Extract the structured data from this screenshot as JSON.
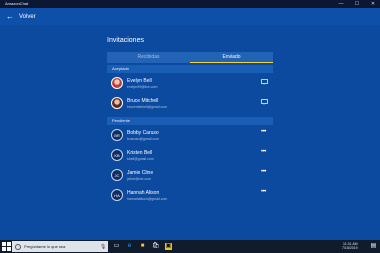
{
  "window": {
    "app_title": "AmazonChat",
    "controls": [
      "—",
      "☐",
      "✕"
    ]
  },
  "header": {
    "back_label": "Volver"
  },
  "page": {
    "title": "Invitaciones"
  },
  "tabs": [
    {
      "label": "Recibidas",
      "selected": false
    },
    {
      "label": "Enviado",
      "selected": true
    }
  ],
  "sections": {
    "accepted": {
      "label": "Aceptado",
      "items": [
        {
          "name": "Evelyn Bell",
          "email": "evelyn99@live.com",
          "avatar": "photo"
        },
        {
          "name": "Bruce Mitchell",
          "email": "brucemitchell@gmail.com",
          "avatar": "photo"
        }
      ]
    },
    "pending": {
      "label": "Pendiente",
      "items": [
        {
          "name": "Bobby Caruso",
          "email": "bcaruso@gmail.com",
          "initials": "BR"
        },
        {
          "name": "Kristen Bell",
          "email": "kbell@gmail.com",
          "initials": "KB"
        },
        {
          "name": "Jamie Cline",
          "email": "jcline@me.com",
          "initials": "JC"
        },
        {
          "name": "Hannah Alison",
          "email": "hannahalison@gmail.com",
          "initials": "HA"
        }
      ]
    }
  },
  "taskbar": {
    "search_placeholder": "Pregúntame lo que sea",
    "time": "11:31 AM",
    "date": "7/15/2019"
  },
  "colors": {
    "accent": "#f3d23a",
    "background": "#0c4aa0",
    "titlebar": "#0b1733",
    "taskbar": "#101b2c"
  }
}
